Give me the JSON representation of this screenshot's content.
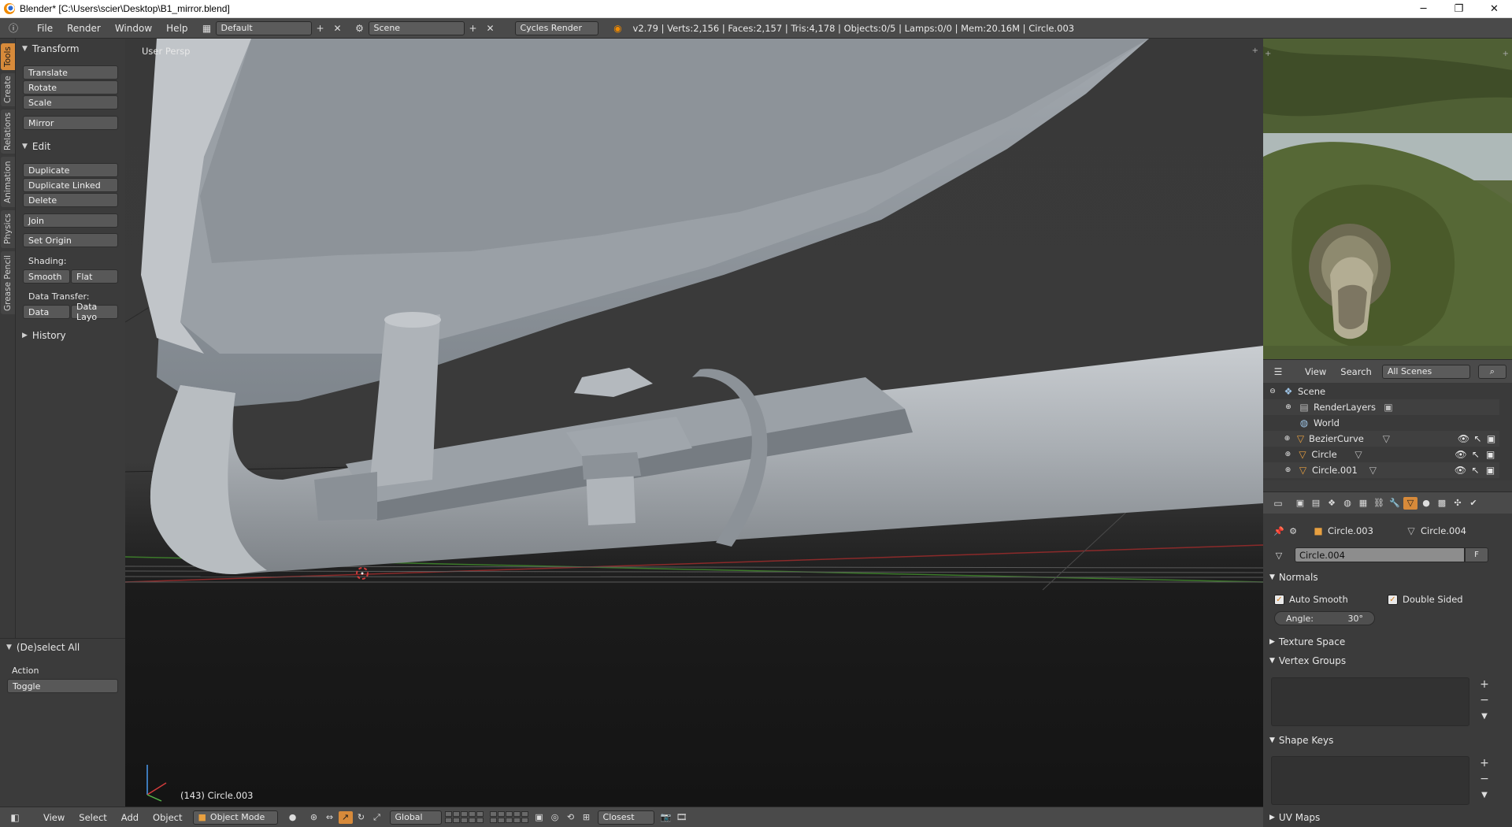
{
  "window": {
    "title": "Blender* [C:\\Users\\scier\\Desktop\\B1_mirror.blend]",
    "minimize": "─",
    "maximize": "❐",
    "close": "✕"
  },
  "info_header": {
    "menus": [
      "File",
      "Render",
      "Window",
      "Help"
    ],
    "screen_layout": "Default",
    "scene": "Scene",
    "render_engine": "Cycles Render",
    "stats": "v2.79 | Verts:2,156 | Faces:2,157 | Tris:4,178 | Objects:0/5 | Lamps:0/0 | Mem:20.16M | Circle.003"
  },
  "tool_tabs": [
    "Tools",
    "Create",
    "Relations",
    "Animation",
    "Physics",
    "Grease Pencil"
  ],
  "tool_shelf": {
    "transform_header": "Transform",
    "translate": "Translate",
    "rotate": "Rotate",
    "scale": "Scale",
    "mirror": "Mirror",
    "edit_header": "Edit",
    "duplicate": "Duplicate",
    "duplicate_linked": "Duplicate Linked",
    "delete": "Delete",
    "join": "Join",
    "set_origin": "Set Origin",
    "shading_label": "Shading:",
    "smooth": "Smooth",
    "flat": "Flat",
    "data_transfer_label": "Data Transfer:",
    "data": "Data",
    "data_layout": "Data Layo",
    "history_header": "History"
  },
  "redo_panel": {
    "header": "(De)select All",
    "action_label": "Action",
    "action_value": "Toggle"
  },
  "viewport": {
    "view_name": "User Persp",
    "object_info": "(143) Circle.003"
  },
  "outliner": {
    "view": "View",
    "search": "Search",
    "filter": "All Scenes",
    "items": [
      {
        "label": "Scene"
      },
      {
        "label": "RenderLayers"
      },
      {
        "label": "World"
      },
      {
        "label": "BezierCurve"
      },
      {
        "label": "Circle"
      },
      {
        "label": "Circle.001"
      }
    ]
  },
  "properties": {
    "object_name": "Circle.003",
    "mesh_name": "Circle.004",
    "datablock": "Circle.004",
    "fake_user": "F",
    "normals_header": "Normals",
    "auto_smooth": "Auto Smooth",
    "double_sided": "Double Sided",
    "angle_label": "Angle:",
    "angle_value": "30°",
    "texture_space": "Texture Space",
    "vertex_groups": "Vertex Groups",
    "shape_keys": "Shape Keys",
    "uv_maps": "UV Maps"
  },
  "bottom_header": {
    "view": "View",
    "select": "Select",
    "add": "Add",
    "object": "Object",
    "mode": "Object Mode",
    "orientation": "Global",
    "snap_target": "Closest"
  }
}
